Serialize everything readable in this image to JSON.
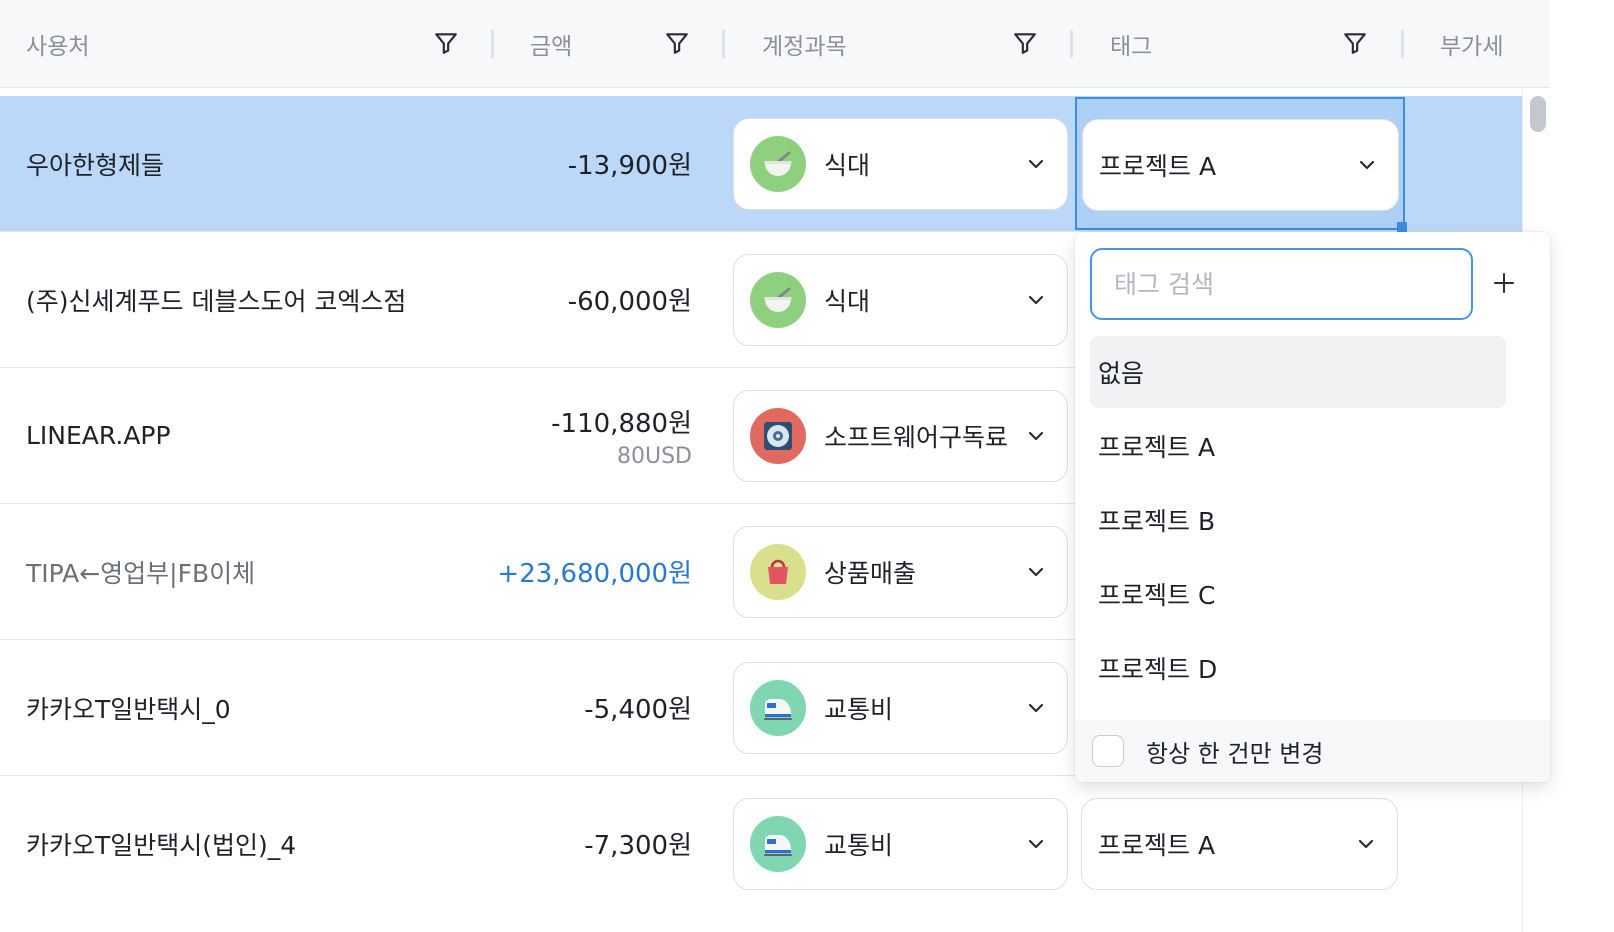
{
  "header": {
    "columns": [
      {
        "label": "사용처"
      },
      {
        "label": "금액"
      },
      {
        "label": "계정과목"
      },
      {
        "label": "태그"
      },
      {
        "label": "부가세"
      }
    ]
  },
  "rows": [
    {
      "vendor": "우아한형제들",
      "amount": "-13,900원",
      "account": "식대",
      "account_icon": "rice-bowl-icon",
      "tag": "프로젝트 A",
      "selected": true
    },
    {
      "vendor": "(주)신세계푸드 데블스도어 코엑스점",
      "amount": "-60,000원",
      "account": "식대",
      "account_icon": "rice-bowl-icon"
    },
    {
      "vendor": "LINEAR.APP",
      "amount": "-110,880원",
      "amount_sub": "80USD",
      "account": "소프트웨어구독료",
      "account_icon": "disc-icon"
    },
    {
      "vendor": "TIPA←영업부|FB이체",
      "amount": "+23,680,000원",
      "account": "상품매출",
      "account_icon": "shopping-bag-icon"
    },
    {
      "vendor": "카카오T일반택시_0",
      "amount": "-5,400원",
      "account": "교통비",
      "account_icon": "train-icon"
    },
    {
      "vendor": "카카오T일반택시(법인)_4",
      "amount": "-7,300원",
      "account": "교통비",
      "account_icon": "train-icon",
      "tag": "프로젝트 A"
    }
  ],
  "dropdown": {
    "search_placeholder": "태그 검색",
    "search_value": "",
    "options": [
      "없음",
      "프로젝트 A",
      "프로젝트 B",
      "프로젝트 C",
      "프로젝트 D"
    ],
    "footer_label": "항상 한 건만 변경",
    "footer_checked": false
  },
  "colors": {
    "selected_row": "#bcd8f8",
    "focus_border": "#3a8ee6",
    "positive_amount": "#2979d0",
    "food_icon_bg": "#8fd07f",
    "software_icon_bg": "#e06a60",
    "sales_icon_bg": "#d9df8c",
    "transport_icon_bg": "#7fd6b0"
  }
}
